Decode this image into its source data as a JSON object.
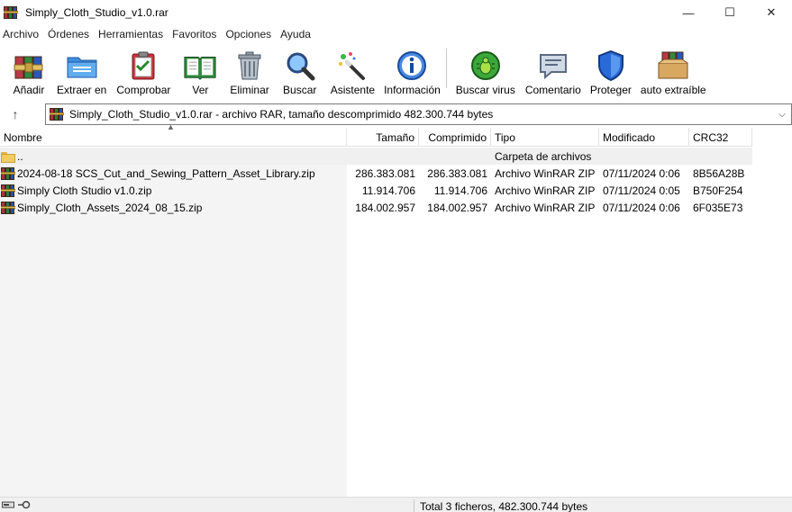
{
  "window": {
    "title": "Simply_Cloth_Studio_v1.0.rar",
    "minimize": "—",
    "maximize": "☐",
    "close": "✕"
  },
  "menu": [
    "Archivo",
    "Órdenes",
    "Herramientas",
    "Favoritos",
    "Opciones",
    "Ayuda"
  ],
  "toolbar": {
    "add": "Añadir",
    "extract": "Extraer en",
    "test": "Comprobar",
    "view": "Ver",
    "delete": "Eliminar",
    "find": "Buscar",
    "wizard": "Asistente",
    "info": "Información",
    "virus": "Buscar virus",
    "comment": "Comentario",
    "protect": "Proteger",
    "sfx": "auto extraíble"
  },
  "address": {
    "up": "↑",
    "text": "Simply_Cloth_Studio_v1.0.rar - archivo RAR, tamaño descomprimido 482.300.744 bytes",
    "dropdown": "⌵"
  },
  "columns": {
    "name": "Nombre",
    "size": "Tamaño",
    "packed": "Comprimido",
    "type": "Tipo",
    "modified": "Modificado",
    "crc": "CRC32"
  },
  "parent_row": {
    "name": "..",
    "type": "Carpeta de archivos"
  },
  "files": [
    {
      "name": "2024-08-18 SCS_Cut_and_Sewing_Pattern_Asset_Library.zip",
      "size": "286.383.081",
      "packed": "286.383.081",
      "type": "Archivo WinRAR ZIP",
      "modified": "07/11/2024 0:06",
      "crc": "8B56A28B"
    },
    {
      "name": "Simply Cloth Studio v1.0.zip",
      "size": "11.914.706",
      "packed": "11.914.706",
      "type": "Archivo WinRAR ZIP",
      "modified": "07/11/2024 0:05",
      "crc": "B750F254"
    },
    {
      "name": "Simply_Cloth_Assets_2024_08_15.zip",
      "size": "184.002.957",
      "packed": "184.002.957",
      "type": "Archivo WinRAR ZIP",
      "modified": "07/11/2024 0:06",
      "crc": "6F035E73"
    }
  ],
  "status": {
    "text": "Total 3 ficheros, 482.300.744 bytes"
  }
}
